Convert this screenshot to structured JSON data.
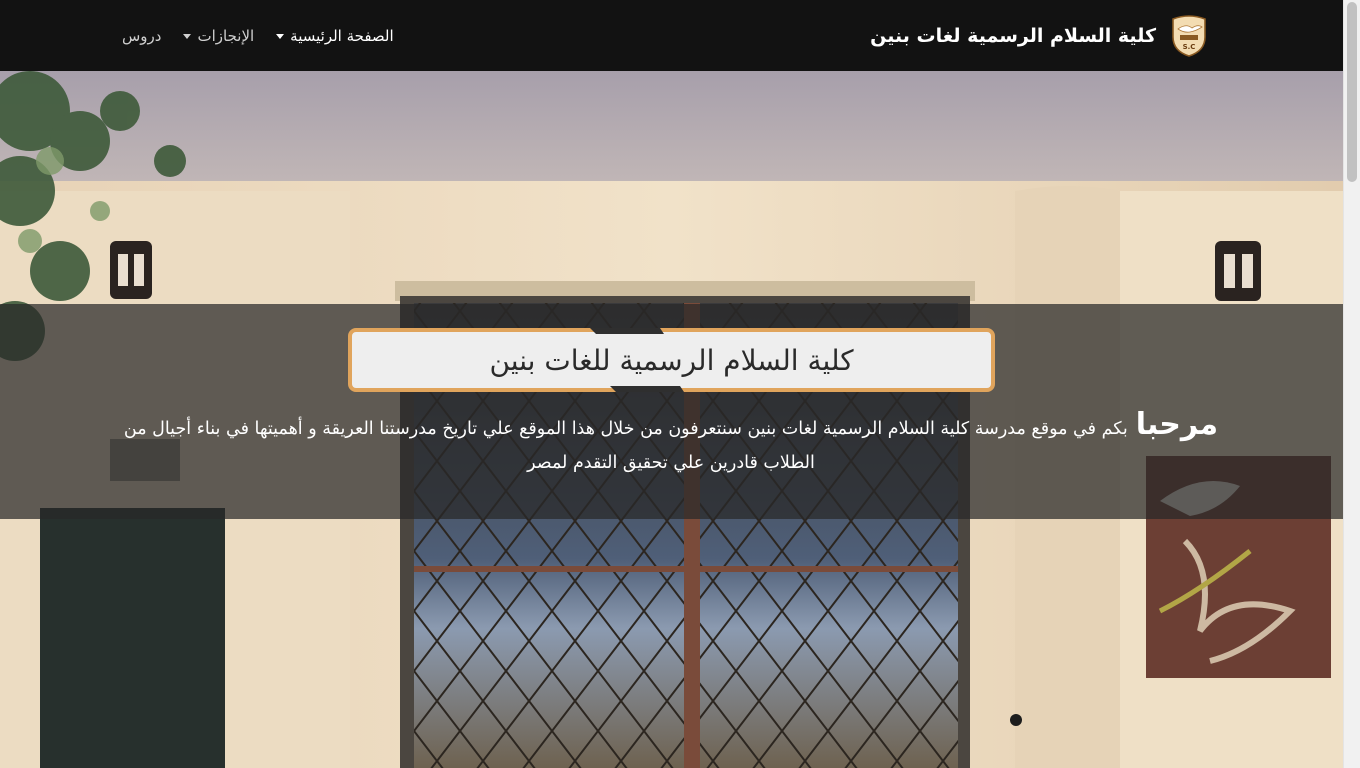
{
  "navbar": {
    "brand": "كلية السلام الرسمية لغات بنين",
    "logo_text": "S.C",
    "items": [
      {
        "label": "الصفحة الرئيسية",
        "dropdown": true,
        "active": true
      },
      {
        "label": "الإنجازات",
        "dropdown": true,
        "active": false
      },
      {
        "label": "دروس",
        "dropdown": false,
        "active": false
      }
    ]
  },
  "hero": {
    "title": "كلية السلام الرسمية للغات بنين",
    "welcome_word": "مرحبا",
    "welcome_text": "بكم في موقع مدرسة كلية السلام الرسمية لغات بنين سنتعرفون من خلال هذا الموقع علي تاريخ مدرستنا العريقة و أهميتها في بناء أجيال من الطلاب قادرين علي تحقيق التقدم لمصر"
  },
  "colors": {
    "navbar_bg": "#121212",
    "title_border": "#e0a45c",
    "title_bg": "#eeeeee"
  }
}
